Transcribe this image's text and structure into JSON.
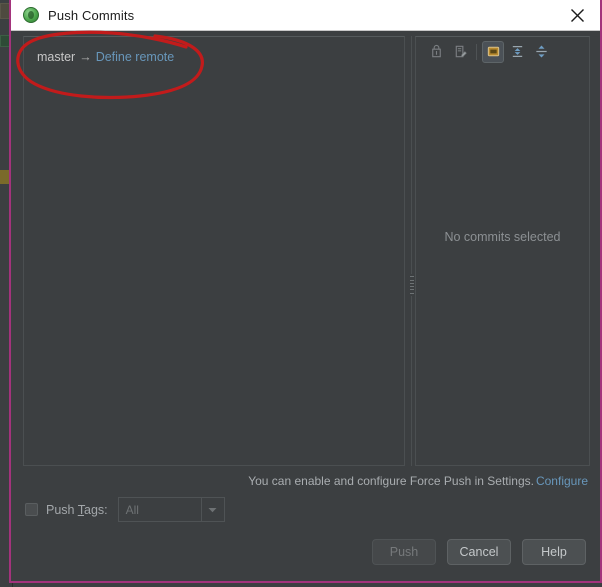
{
  "window": {
    "title": "Push Commits",
    "icon": "git-branch-icon",
    "close_label": "×",
    "border_color": "#a3337c"
  },
  "commit_list": {
    "repo_name": "master",
    "arrow": "→",
    "define_remote_label": "Define remote"
  },
  "details": {
    "empty_message": "No commits selected",
    "toolbar": [
      {
        "name": "revert-icon",
        "selected": false,
        "enabled": false
      },
      {
        "name": "edit-commit-message-icon",
        "selected": false,
        "enabled": false
      },
      {
        "name": "show-diff-in-editor-icon",
        "selected": true,
        "enabled": true
      },
      {
        "name": "expand-all-icon",
        "selected": false,
        "enabled": true
      },
      {
        "name": "collapse-all-icon",
        "selected": false,
        "enabled": true
      }
    ]
  },
  "footer": {
    "force_push_hint": "You can enable and configure Force Push in Settings.",
    "configure_link": "Configure",
    "push_tags_label_pre": "Push ",
    "push_tags_label_mnemonic": "T",
    "push_tags_label_post": "ags:",
    "push_tags_checked": false,
    "push_tags_value": "All",
    "push_tags_options": [
      "All"
    ]
  },
  "buttons": {
    "push": "Push",
    "push_enabled": false,
    "cancel": "Cancel",
    "help": "Help"
  },
  "annotation": {
    "type": "hand-drawn-ellipse",
    "color": "#c21b1b",
    "target": "master → Define remote"
  },
  "colors": {
    "dialog_bg": "#3c3f41",
    "titlebar_bg": "#ffffff",
    "link": "#6897bb",
    "window_border": "#a3337c",
    "annotation": "#c21b1b"
  }
}
